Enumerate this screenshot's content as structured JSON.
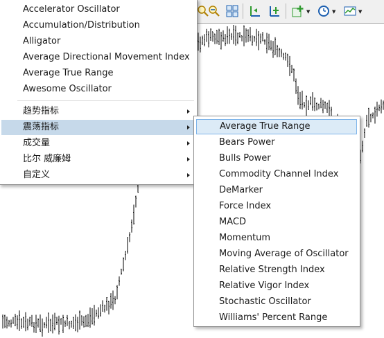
{
  "toolbar": {
    "icons": [
      "zoom-in-icon",
      "zoom-out-icon",
      "tile-windows-icon",
      "chart-shift-icon",
      "auto-scroll-icon",
      "indicators-icon",
      "periods-icon",
      "templates-icon"
    ],
    "colors": {
      "accent_green": "#2e9a2e",
      "accent_blue": "#1c5fb0"
    }
  },
  "main_menu": {
    "items": [
      {
        "label": "Accelerator Oscillator"
      },
      {
        "label": "Accumulation/Distribution"
      },
      {
        "label": "Alligator"
      },
      {
        "label": "Average Directional Movement Index"
      },
      {
        "label": "Average True Range"
      },
      {
        "label": "Awesome Oscillator"
      }
    ],
    "submenus": [
      {
        "label": "趋势指标"
      },
      {
        "label": "震荡指标"
      },
      {
        "label": "成交量"
      },
      {
        "label": "比尔 威廉姆"
      },
      {
        "label": "自定义"
      }
    ],
    "highlighted": "震荡指标"
  },
  "sub_menu": {
    "items": [
      {
        "label": "Average True Range"
      },
      {
        "label": "Bears Power"
      },
      {
        "label": "Bulls Power"
      },
      {
        "label": "Commodity Channel Index"
      },
      {
        "label": "DeMarker"
      },
      {
        "label": "Force Index"
      },
      {
        "label": "MACD"
      },
      {
        "label": "Momentum"
      },
      {
        "label": "Moving Average of Oscillator"
      },
      {
        "label": "Relative Strength Index"
      },
      {
        "label": "Relative Vigor Index"
      },
      {
        "label": "Stochastic Oscillator"
      },
      {
        "label": "Williams' Percent Range"
      }
    ],
    "highlighted": "Average True Range"
  },
  "colors": {
    "menu_highlight": "#c6d9ea",
    "hover_border": "#7eb4ea",
    "bars": "#000000"
  }
}
